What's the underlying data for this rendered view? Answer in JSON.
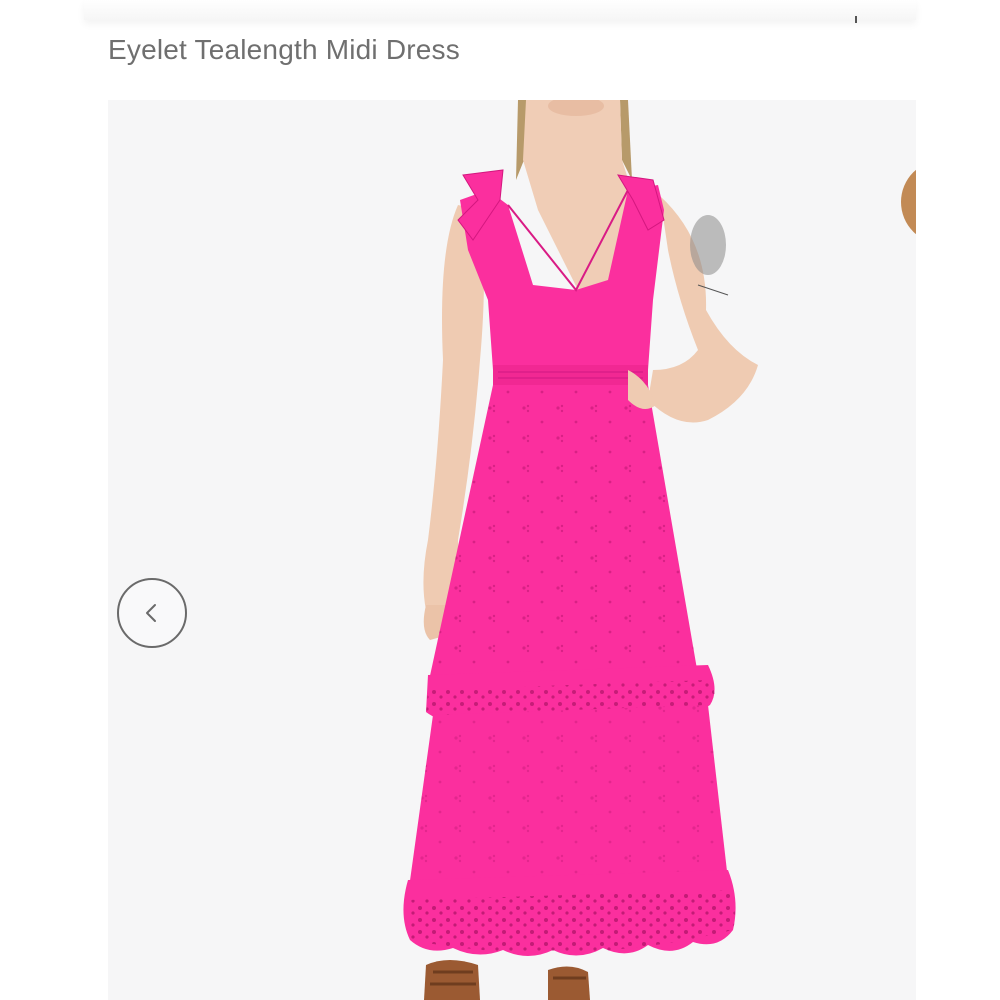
{
  "product": {
    "title": "Eyelet Tealength Midi Dress"
  },
  "gallery": {
    "image_subject": "dress-photo",
    "dress_color": "#fb2f9e",
    "background_color": "#f6f6f7"
  },
  "controls": {
    "prev_icon": "chevron-left-icon",
    "next_thumbnail_color": "#c28a55"
  }
}
